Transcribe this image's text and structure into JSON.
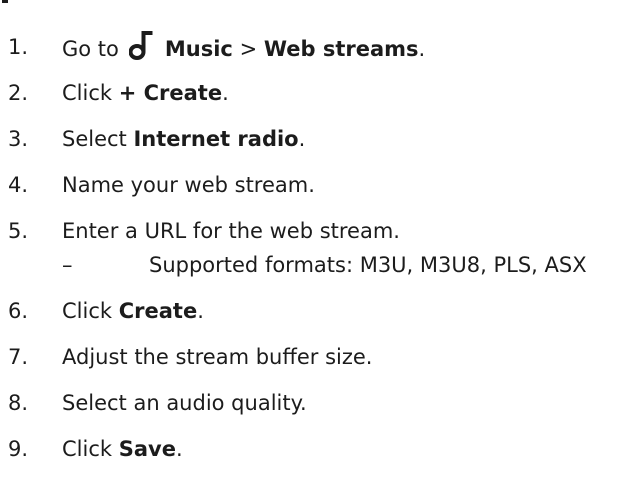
{
  "steps": [
    {
      "num": "1.",
      "pre": "Go to",
      "icon": "music-note-icon",
      "bold1": "Music",
      "sep": " > ",
      "bold2": "Web streams",
      "post": "."
    },
    {
      "num": "2.",
      "pre": "Click ",
      "bold": "+ Create",
      "post": "."
    },
    {
      "num": "3.",
      "pre": "Select ",
      "bold": "Internet radio",
      "post": "."
    },
    {
      "num": "4.",
      "text": "Name your web stream."
    },
    {
      "num": "5.",
      "text": "Enter a URL for the web stream."
    },
    {
      "num": "6.",
      "pre": "Click ",
      "bold": "Create",
      "post": "."
    },
    {
      "num": "7.",
      "text": "Adjust the stream buffer size."
    },
    {
      "num": "8.",
      "text": "Select an audio quality."
    },
    {
      "num": "9.",
      "pre": "Click ",
      "bold": "Save",
      "post": "."
    }
  ],
  "substep": {
    "dash": "–",
    "text": "Supported formats: M3U, M3U8, PLS, ASX"
  }
}
